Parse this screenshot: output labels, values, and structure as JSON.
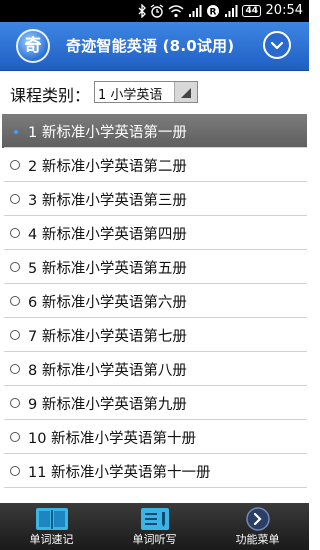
{
  "status_bar": {
    "time": "20:54",
    "battery": "44",
    "icons": [
      "bluetooth-icon",
      "alarm-icon",
      "wifi-icon",
      "signal-icon",
      "r-badge-icon",
      "signal-2-icon"
    ]
  },
  "header": {
    "logo_char": "奇",
    "title": "奇迹智能英语 (8.0试用)"
  },
  "category": {
    "label": "课程类别：",
    "selected_value": "1 小学英语"
  },
  "course_list": {
    "selected_index": 0,
    "items": [
      "1 新标准小学英语第一册",
      "2 新标准小学英语第二册",
      "3 新标准小学英语第三册",
      "4 新标准小学英语第四册",
      "5 新标准小学英语第五册",
      "6 新标准小学英语第六册",
      "7 新标准小学英语第七册",
      "8 新标准小学英语第八册",
      "9 新标准小学英语第九册",
      "10 新标准小学英语第十册",
      "11 新标准小学英语第十一册"
    ]
  },
  "bottom_tabs": [
    {
      "label": "单词速记",
      "icon": "book-icon"
    },
    {
      "label": "单词听写",
      "icon": "notepad-pen-icon"
    },
    {
      "label": "功能菜单",
      "icon": "menu-arrow-icon"
    }
  ],
  "colors": {
    "header_top": "#3e86e3",
    "header_bottom": "#1f5fc4",
    "selected_row": "#6b6b6b",
    "radio_dot": "#3aa0ff",
    "bottom_bar": "#262626"
  }
}
